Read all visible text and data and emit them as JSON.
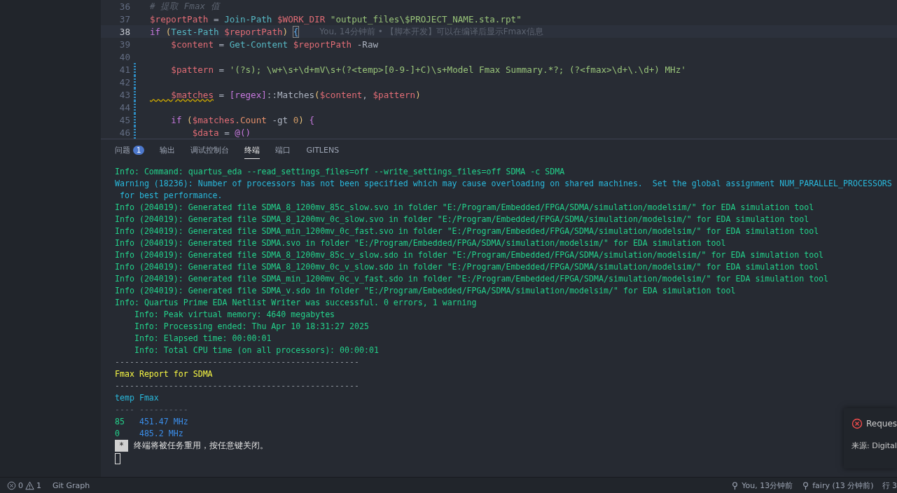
{
  "editor": {
    "lines": [
      {
        "number": "36",
        "current": false,
        "modified": false,
        "tokens": [
          {
            "text": "# 提取 Fmax 值",
            "kind": "comment"
          }
        ]
      },
      {
        "number": "37",
        "current": false,
        "modified": false,
        "tokens": [
          {
            "text": "$reportPath",
            "kind": "var"
          },
          {
            "text": " = ",
            "kind": "plain"
          },
          {
            "text": "Join-Path ",
            "kind": "func"
          },
          {
            "text": "$WORK_DIR ",
            "kind": "var"
          },
          {
            "text": "\"output_files\\$PROJECT_NAME.sta.rpt\"",
            "kind": "string"
          }
        ]
      },
      {
        "number": "38",
        "current": true,
        "modified": false,
        "blame": "You, 14分钟前 • 【脚本开发】可以在编译后显示Fmax信息",
        "tokens": [
          {
            "text": "if ",
            "kind": "keyword"
          },
          {
            "text": "(",
            "kind": "bracket"
          },
          {
            "text": "Test-Path ",
            "kind": "func"
          },
          {
            "text": "$reportPath",
            "kind": "var"
          },
          {
            "text": ") ",
            "kind": "bracket"
          },
          {
            "text": "{",
            "kind": "matched"
          }
        ]
      },
      {
        "number": "39",
        "current": false,
        "modified": false,
        "tokens": [
          {
            "text": "    $content",
            "kind": "var"
          },
          {
            "text": " = ",
            "kind": "plain"
          },
          {
            "text": "Get-Content ",
            "kind": "func"
          },
          {
            "text": "$reportPath",
            "kind": "var"
          },
          {
            "text": " -Raw",
            "kind": "plain"
          }
        ]
      },
      {
        "number": "40",
        "current": false,
        "modified": false
      },
      {
        "number": "41",
        "current": false,
        "modified": true,
        "tokens": [
          {
            "text": "    $pattern",
            "kind": "var"
          },
          {
            "text": " = ",
            "kind": "plain"
          },
          {
            "text": "'(?s); \\w+\\s+\\d+mV\\s+(?<temp>[0-9-]+C)\\s+Model Fmax Summary.*?; (?<fmax>\\d+\\.\\d+) MHz'",
            "kind": "string"
          }
        ]
      },
      {
        "number": "42",
        "current": false,
        "modified": true
      },
      {
        "number": "43",
        "current": false,
        "modified": true,
        "tokens": [
          {
            "text": "    $matches",
            "kind": "var",
            "warning": true
          },
          {
            "text": " = ",
            "kind": "plain"
          },
          {
            "text": "[regex]",
            "kind": "type"
          },
          {
            "text": "::Matches",
            "kind": "plain"
          },
          {
            "text": "(",
            "kind": "bracket"
          },
          {
            "text": "$content",
            "kind": "var"
          },
          {
            "text": ", ",
            "kind": "plain"
          },
          {
            "text": "$pattern",
            "kind": "var"
          },
          {
            "text": ")",
            "kind": "bracket"
          }
        ]
      },
      {
        "number": "44",
        "current": false,
        "modified": true
      },
      {
        "number": "45",
        "current": false,
        "modified": true,
        "tokens": [
          {
            "text": "    if ",
            "kind": "keyword"
          },
          {
            "text": "(",
            "kind": "bracket"
          },
          {
            "text": "$matches",
            "kind": "var"
          },
          {
            "text": ".Count",
            "kind": "property"
          },
          {
            "text": " -gt ",
            "kind": "plain"
          },
          {
            "text": "0",
            "kind": "number"
          },
          {
            "text": ") ",
            "kind": "bracket"
          },
          {
            "text": "{",
            "kind": "bracket2"
          }
        ]
      },
      {
        "number": "46",
        "current": false,
        "modified": true,
        "tokens": [
          {
            "text": "        $data",
            "kind": "var"
          },
          {
            "text": " = ",
            "kind": "plain"
          },
          {
            "text": "@()",
            "kind": "keyword"
          }
        ]
      }
    ]
  },
  "panel": {
    "tabs": [
      {
        "label": "问题",
        "selected": false,
        "badge": "1"
      },
      {
        "label": "输出",
        "selected": false
      },
      {
        "label": "调试控制台",
        "selected": false
      },
      {
        "label": "终端",
        "selected": true
      },
      {
        "label": "端口",
        "selected": false
      },
      {
        "label": "GITLENS",
        "selected": false
      }
    ],
    "terminal": [
      [
        {
          "text": "Info: Command: quartus_eda --read_settings_files=off --write_settings_files=off SDMA -c SDMA",
          "kind": "info"
        }
      ],
      [
        {
          "text": "Warning (18236): Number of processors has not been specified which may cause overloading on shared machines.  Set the global assignment NUM_PARALLEL_PROCESSORS",
          "kind": "warning"
        }
      ],
      [
        {
          "text": " for best performance.",
          "kind": "warning"
        }
      ],
      [
        {
          "text": "Info (204019): Generated file SDMA_8_1200mv_85c_slow.svo in folder \"E:/Program/Embedded/FPGA/SDMA/simulation/modelsim/\" for EDA simulation tool",
          "kind": "info"
        }
      ],
      [
        {
          "text": "Info (204019): Generated file SDMA_8_1200mv_0c_slow.svo in folder \"E:/Program/Embedded/FPGA/SDMA/simulation/modelsim/\" for EDA simulation tool",
          "kind": "info"
        }
      ],
      [
        {
          "text": "Info (204019): Generated file SDMA_min_1200mv_0c_fast.svo in folder \"E:/Program/Embedded/FPGA/SDMA/simulation/modelsim/\" for EDA simulation tool",
          "kind": "info"
        }
      ],
      [
        {
          "text": "Info (204019): Generated file SDMA.svo in folder \"E:/Program/Embedded/FPGA/SDMA/simulation/modelsim/\" for EDA simulation tool",
          "kind": "info"
        }
      ],
      [
        {
          "text": "Info (204019): Generated file SDMA_8_1200mv_85c_v_slow.sdo in folder \"E:/Program/Embedded/FPGA/SDMA/simulation/modelsim/\" for EDA simulation tool",
          "kind": "info"
        }
      ],
      [
        {
          "text": "Info (204019): Generated file SDMA_8_1200mv_0c_v_slow.sdo in folder \"E:/Program/Embedded/FPGA/SDMA/simulation/modelsim/\" for EDA simulation tool",
          "kind": "info"
        }
      ],
      [
        {
          "text": "Info (204019): Generated file SDMA_min_1200mv_0c_v_fast.sdo in folder \"E:/Program/Embedded/FPGA/SDMA/simulation/modelsim/\" for EDA simulation tool",
          "kind": "info"
        }
      ],
      [
        {
          "text": "Info (204019): Generated file SDMA_v.sdo in folder \"E:/Program/Embedded/FPGA/SDMA/simulation/modelsim/\" for EDA simulation tool",
          "kind": "info"
        }
      ],
      [
        {
          "text": "Info: Quartus Prime EDA Netlist Writer was successful. 0 errors, 1 warning",
          "kind": "info"
        }
      ],
      [
        {
          "text": "    Info: Peak virtual memory: 4640 megabytes",
          "kind": "info"
        }
      ],
      [
        {
          "text": "    Info: Processing ended: Thu Apr 10 18:31:27 2025",
          "kind": "info"
        }
      ],
      [
        {
          "text": "    Info: Elapsed time: 00:00:01",
          "kind": "info"
        }
      ],
      [
        {
          "text": "    Info: Total CPU time (on all processors): 00:00:01",
          "kind": "info"
        }
      ],
      [
        {
          "text": "--------------------------------------------------",
          "kind": "rule"
        }
      ],
      [
        {
          "text": "Fmax Report for SDMA",
          "kind": "heading"
        }
      ],
      [
        {
          "text": "--------------------------------------------------",
          "kind": "rule"
        }
      ],
      [
        {
          "text": "temp Fmax",
          "kind": "header"
        }
      ],
      [
        {
          "text": "---- ----------",
          "kind": "dim"
        }
      ],
      [
        {
          "text": "85   ",
          "kind": "info"
        },
        {
          "text": "451.47 MHz",
          "kind": "value"
        }
      ],
      [
        {
          "text": "0    ",
          "kind": "info"
        },
        {
          "text": "485.2 MHz",
          "kind": "value"
        }
      ]
    ],
    "task_notice": {
      "mark": "*",
      "text": "终端将被任务重用，按任意键关闭。"
    }
  },
  "toast": {
    "title": "Reques",
    "source": "来源: Digital"
  },
  "status_bar": {
    "errors": "0",
    "warnings": "1",
    "git_graph": "Git Graph",
    "blame": "You, 13分钟前",
    "author": "fairy (13 分钟前)",
    "position": "行 3"
  }
}
